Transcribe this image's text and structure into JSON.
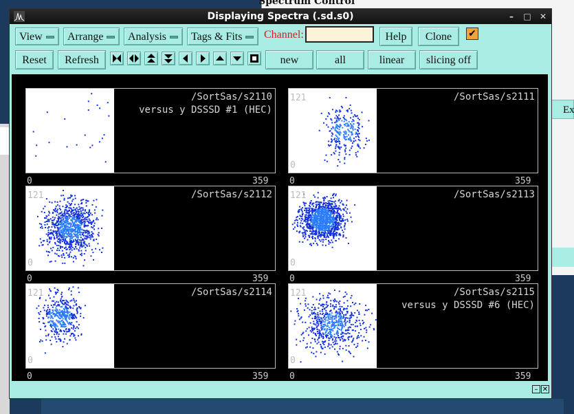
{
  "background": {
    "window_title": "Spectrum Control",
    "side_label": "Ex"
  },
  "window": {
    "title": "Displaying Spectra (.sd.s0)",
    "minimize": "–",
    "maximize": "□",
    "close": "✕"
  },
  "toolbar": {
    "menus": [
      "View",
      "Arrange",
      "Analysis",
      "Tags & Fits"
    ],
    "channel_label": "Channel:",
    "channel_value": "",
    "help": "Help",
    "clone": "Clone",
    "checked": "✔",
    "reset": "Reset",
    "refresh": "Refresh",
    "nav_icons": [
      "first-icon",
      "expand-horizontal-icon",
      "expand-vertical-icon",
      "collapse-vertical-icon",
      "left-icon",
      "right-icon",
      "up-icon",
      "down-icon",
      "stop-square-icon"
    ],
    "new": "new",
    "all": "all",
    "linear": "linear",
    "slicing": "slicing off"
  },
  "panels": [
    {
      "name": "/SortSas/s2110",
      "subtitle": "versus y DSSSD #1 (HEC)",
      "ymax": "",
      "ymin": "",
      "xmin": "0",
      "xmax": "359",
      "density": "sparse"
    },
    {
      "name": "/SortSas/s2111",
      "subtitle": "",
      "ymax": "121",
      "ymin": "0",
      "xmin": "0",
      "xmax": "359",
      "density": "medium-right"
    },
    {
      "name": "/SortSas/s2112",
      "subtitle": "",
      "ymax": "121",
      "ymin": "0",
      "xmin": "0",
      "xmax": "359",
      "density": "dense"
    },
    {
      "name": "/SortSas/s2113",
      "subtitle": "",
      "ymax": "121",
      "ymin": "0",
      "xmin": "0",
      "xmax": "359",
      "density": "blob"
    },
    {
      "name": "/SortSas/s2114",
      "subtitle": "",
      "ymax": "121",
      "ymin": "0",
      "xmin": "0",
      "xmax": "359",
      "density": "cluster"
    },
    {
      "name": "/SortSas/s2115",
      "subtitle": "versus y DSSSD #6 (HEC)",
      "ymax": "121",
      "ymin": "0",
      "xmin": "0",
      "xmax": "359",
      "density": "diffuse"
    }
  ],
  "status_buttons": [
    "–",
    "✕"
  ],
  "colors": {
    "window_bg": "#a8ece4",
    "display_bg": "#000000",
    "point": "#1030e0",
    "point_core": "#2a7cff",
    "channel_label": "#d81b1b",
    "check_bg": "#f2a33a"
  }
}
